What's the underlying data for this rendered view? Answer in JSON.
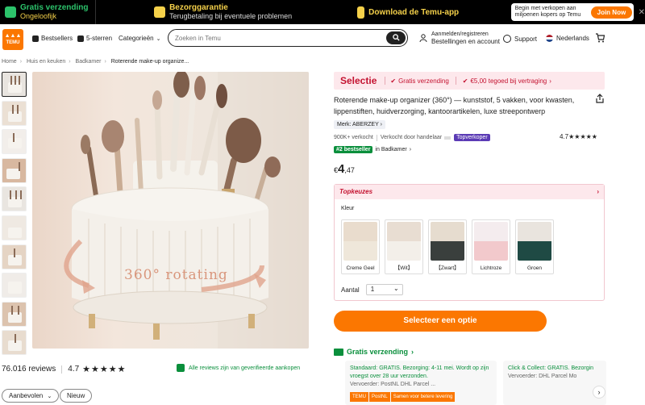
{
  "promo": {
    "free_title": "Gratis verzending",
    "free_sub": "Ongeloofijk",
    "guarantee_title": "Bezorggarantie",
    "guarantee_sub": "Terugbetaling bij eventuele problemen",
    "download": "Download de Temu-app",
    "join_text": "Begin met verkopen aan miljoenen kopers op Temu",
    "join_button": "Join Now"
  },
  "header": {
    "logo": "TEMU",
    "bestsellers": "Bestsellers",
    "five_stars": "5-sterren",
    "categories": "Categorieën",
    "search_placeholder": "Zoeken in Temu",
    "account_top": "Aanmelden/registreren",
    "account_bottom": "Bestellingen en account",
    "support": "Support",
    "language": "Nederlands"
  },
  "breadcrumb": [
    "Home",
    "Huis en keuken",
    "Badkamer",
    "Roterende make-up organize..."
  ],
  "image_text": "360° rotating",
  "reviews": {
    "count": "76.016 reviews",
    "score": "4.7",
    "stars": "★★★★★",
    "verified": "Alle reviews zijn van geverifieerde aankopen",
    "filters": [
      "Aanbevolen",
      "Nieuw"
    ]
  },
  "product": {
    "selectie": "Selectie",
    "free_shipping": "Gratis verzending",
    "credit": "€5,00 tegoed bij vertraging",
    "title": "Roterende make-up organizer (360°) — kunststof, 5 vakken, voor kwasten, lippenstiften, huidverzorging, kantoorartikelen, luxe streepontwerp",
    "brand": "Merk: ABERZEY",
    "sold": "900K+ verkocht",
    "seller": "Verkocht door handelaar",
    "top_seller": "Topverkoper",
    "rating": "4.7★★★★★",
    "bestseller_badge": "#2 bestseller",
    "bestseller_cat": "in Badkamer",
    "price_currency": "€",
    "price_main": "4",
    "price_cents": ",47"
  },
  "topkeuzes": {
    "title": "Topkeuzes",
    "kleur_label": "Kleur",
    "options": [
      {
        "label": "Creme Geel",
        "color": "#efe7da"
      },
      {
        "label": "【Wit】",
        "color": "#f3efe9"
      },
      {
        "label": "【Zwart】",
        "color": "#3a3f3d"
      },
      {
        "label": "Lichtroze",
        "color": "#f2c9cc"
      },
      {
        "label": "Groen",
        "color": "#1f4a44"
      }
    ],
    "quantity_label": "Aantal",
    "quantity_value": "1"
  },
  "cta": "Selecteer een optie",
  "shipping": {
    "title": "Gratis verzending",
    "standard": "Standaard: GRATIS. Bezorging: 4-11 mei. Wordt op zijn vroegst over 28 uur verzonden.",
    "standard_carriers": "Vervoerder: PostNL DHL Parcel ...",
    "collect": "Click & Collect: GRATIS. Bezorgin",
    "collect_carriers": "Vervoerder: DHL Parcel Mo",
    "badge1": "TEMU",
    "badge2": "PostNL",
    "badge3": "Samen voor betere levering"
  },
  "colors": {
    "accent": "#fb7701",
    "green": "#0a8f3c",
    "red": "#c41230"
  }
}
